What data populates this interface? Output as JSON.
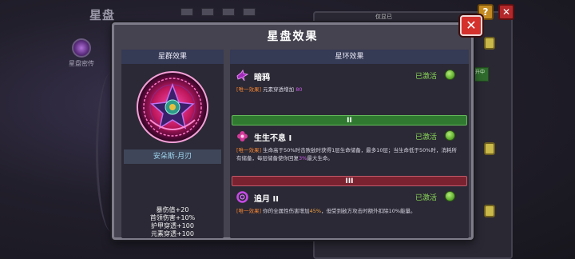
{
  "background": {
    "title": "星盘",
    "side_item_label": "星盘密传",
    "top_bar_text": "仅显已",
    "help_label": "?",
    "close_label": "✕",
    "side_tag": "升中"
  },
  "modal": {
    "title": "星盘效果",
    "close_label": "✕",
    "left": {
      "header": "星群效果",
      "emblem_name": "安朵斯-月刃",
      "stats": [
        "暴伤值+20",
        "首领伤害+10%",
        "护甲穿透+100",
        "元素穿透+100"
      ]
    },
    "right": {
      "header": "星环效果",
      "effects": [
        {
          "name": "暗鸦",
          "status": "已激活",
          "desc_tag": "[唯一效果]",
          "desc_text": "元素穿透增加",
          "desc_value": "80"
        },
        {
          "tier": "II",
          "name": "生生不息 I",
          "status": "已激活",
          "desc_tag": "[唯一效果]",
          "desc_text_1": "生命高于50%时击败敌时获得1层生命储备，最多10层；当生命低于50%时，消耗所有储备，每层储备使你回复",
          "desc_value": "3%",
          "desc_text_2": "最大生命。"
        },
        {
          "tier": "III",
          "name": "追月 II",
          "status": "已激活",
          "desc_tag": "[唯一效果]",
          "desc_text_1": "你的全属性伤害增加",
          "desc_value": "45%",
          "desc_text_2": "，但受到敌方攻击时额外扣除10%能量。"
        }
      ]
    }
  },
  "colors": {
    "active_green": "#8bdc58",
    "tag_orange": "#f08232",
    "value_purple": "#c95ce8",
    "tier2_green": "#2f7a30",
    "tier3_red": "#7a2230",
    "close_red": "#d4302c"
  },
  "icons": {
    "effect_1": "raven-icon",
    "effect_2": "flower-icon",
    "effect_3": "moon-ring-icon",
    "status": "green-orb-icon"
  }
}
